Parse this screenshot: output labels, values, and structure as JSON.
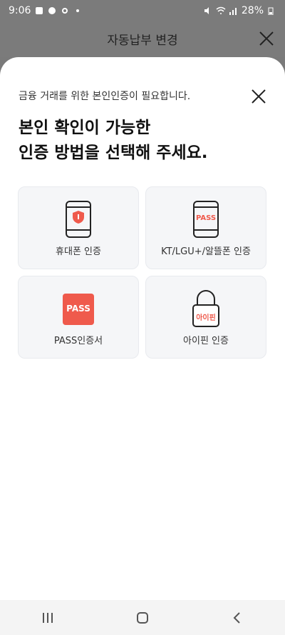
{
  "status_bar": {
    "time": "9:06",
    "battery": "28%"
  },
  "header": {
    "title": "자동납부 변경"
  },
  "sheet": {
    "subtitle": "금융 거래를 위한 본인인증이 필요합니다.",
    "title": "본인 확인이 가능한\n인증 방법을 선택해 주세요."
  },
  "methods": [
    {
      "label": "휴대폰 인증",
      "icon": "phone-shield-icon"
    },
    {
      "label": "KT/LGU+/알뜰폰 인증",
      "icon": "phone-pass-icon",
      "badge": "PASS"
    },
    {
      "label": "PASS인증서",
      "icon": "pass-icon",
      "badge": "PASS"
    },
    {
      "label": "아이핀 인증",
      "icon": "ipin-lock-icon",
      "badge": "아이핀"
    }
  ],
  "colors": {
    "accent": "#ef5a4c",
    "card_bg": "#f5f6f8"
  }
}
